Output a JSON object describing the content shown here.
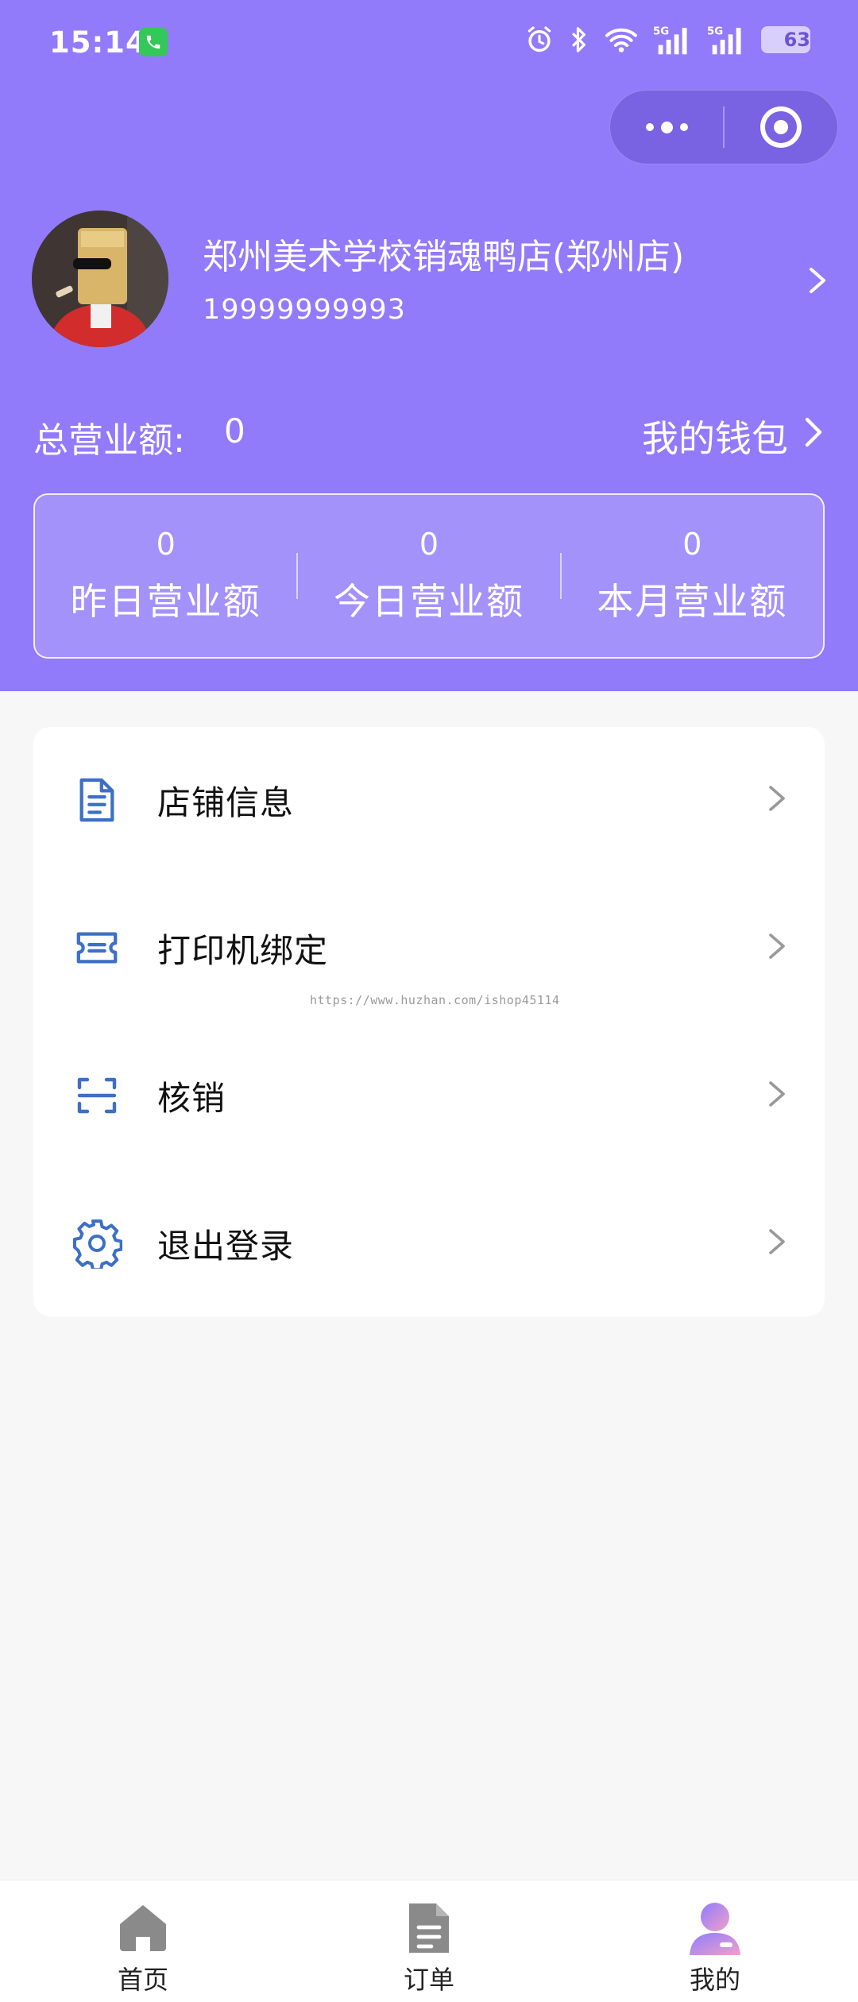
{
  "status_bar": {
    "time": "15:14",
    "battery": "63"
  },
  "profile": {
    "shop_name": "郑州美术学校销魂鸭店(郑州店)",
    "phone": "19999999993"
  },
  "revenue": {
    "total_label": "总营业额:",
    "total_value": "0",
    "wallet_label": "我的钱包"
  },
  "stats": [
    {
      "value": "0",
      "label": "昨日营业额"
    },
    {
      "value": "0",
      "label": "今日营业额"
    },
    {
      "value": "0",
      "label": "本月营业额"
    }
  ],
  "menu": [
    {
      "label": "店铺信息",
      "icon": "document-icon"
    },
    {
      "label": "打印机绑定",
      "icon": "ticket-icon"
    },
    {
      "label": "核销",
      "icon": "scan-icon"
    },
    {
      "label": "退出登录",
      "icon": "gear-icon"
    }
  ],
  "watermark": "https://www.huzhan.com/ishop45114",
  "tabs": [
    {
      "label": "首页",
      "icon": "home-icon"
    },
    {
      "label": "订单",
      "icon": "order-icon"
    },
    {
      "label": "我的",
      "icon": "profile-icon"
    }
  ],
  "colors": {
    "header_bg": "#917bfb",
    "menu_icon": "#3d6fc6",
    "page_bg": "#f7f7f8"
  }
}
